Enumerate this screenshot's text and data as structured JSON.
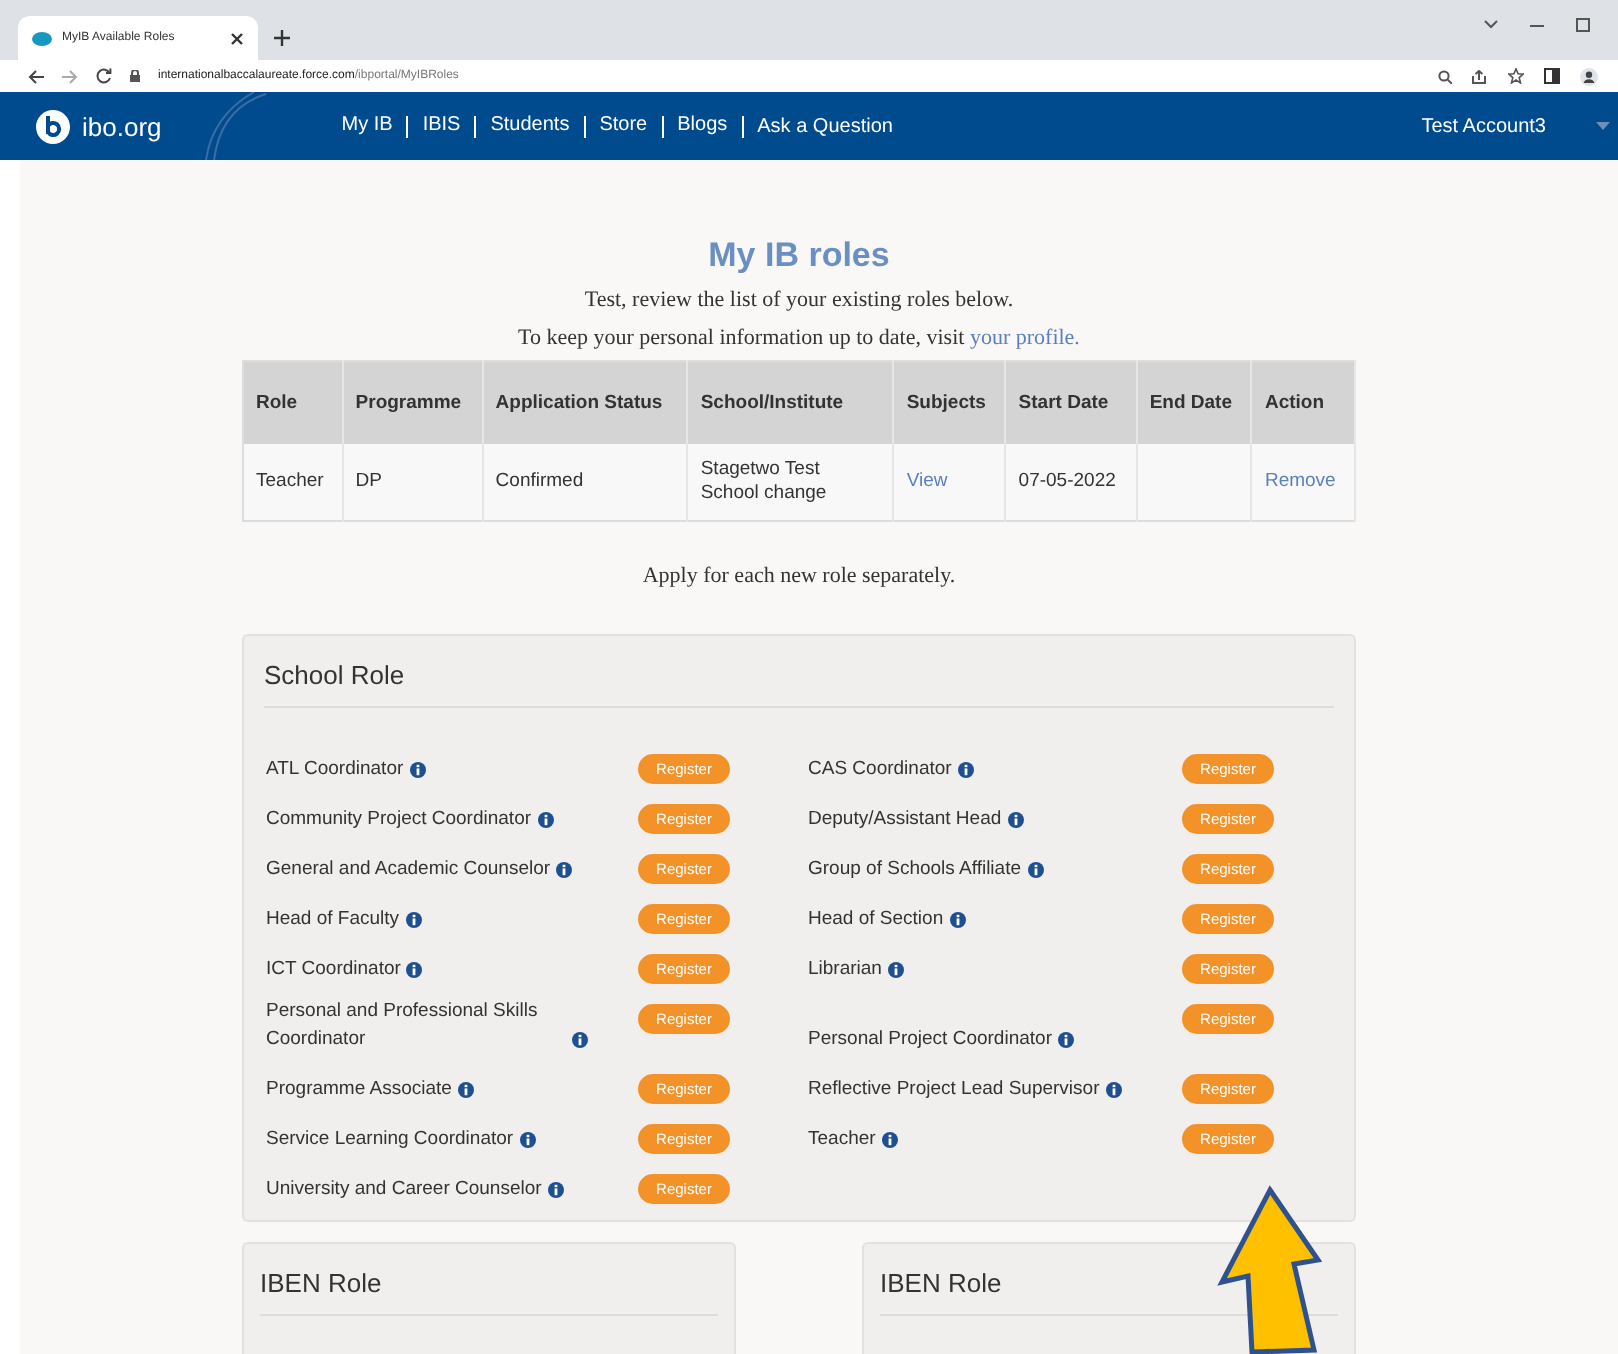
{
  "browser": {
    "tab_title": "MyIB Available Roles",
    "url_host": "internationalbaccalaureate.force.com",
    "url_path": "/ibportal/MyIBRoles"
  },
  "nav": {
    "logo_text": "ibo.org",
    "links": [
      "My IB",
      "IBIS",
      "Students",
      "Store",
      "Blogs",
      "Ask a Question"
    ],
    "account": "Test Account3"
  },
  "page": {
    "title": "My IB roles",
    "intro": "Test, review the list of your existing roles below.",
    "profile_text": "To keep your personal information up to date, visit ",
    "profile_link": "your profile.",
    "apply_note": "Apply for each new role separately."
  },
  "table": {
    "columns": [
      "Role",
      "Programme",
      "Application Status",
      "School/Institute",
      "Subjects",
      "Start Date",
      "End Date",
      "Action"
    ],
    "rows": [
      {
        "role": "Teacher",
        "programme": "DP",
        "status": "Confirmed",
        "school": "Stagetwo Test School change",
        "subjects_link": "View",
        "start_date": "07-05-2022",
        "end_date": "",
        "action_link": "Remove"
      }
    ]
  },
  "school_role": {
    "title": "School Role",
    "roles": [
      {
        "name": "ATL Coordinator",
        "button": "Register"
      },
      {
        "name": "CAS Coordinator",
        "button": "Register"
      },
      {
        "name": "Community Project Coordinator",
        "button": "Register"
      },
      {
        "name": "Deputy/Assistant Head",
        "button": "Register"
      },
      {
        "name": "General and Academic Counselor",
        "button": "Register"
      },
      {
        "name": "Group of Schools Affiliate",
        "button": "Register"
      },
      {
        "name": "Head of Faculty",
        "button": "Register"
      },
      {
        "name": "Head of Section",
        "button": "Register"
      },
      {
        "name": "ICT Coordinator",
        "button": "Register"
      },
      {
        "name": "Librarian",
        "button": "Register"
      },
      {
        "name": "Personal and Professional Skills Coordinator",
        "button": "Register"
      },
      {
        "name": "Personal Project Coordinator",
        "button": "Register"
      },
      {
        "name": "Programme Associate",
        "button": "Register"
      },
      {
        "name": "Reflective Project Lead Supervisor",
        "button": "Register"
      },
      {
        "name": "Service Learning Coordinator",
        "button": "Register"
      },
      {
        "name": "Teacher",
        "button": "Register"
      },
      {
        "name": "University and Career Counselor",
        "button": "Register"
      }
    ]
  },
  "iben_panels": [
    "IBEN Role",
    "IBEN Role"
  ]
}
